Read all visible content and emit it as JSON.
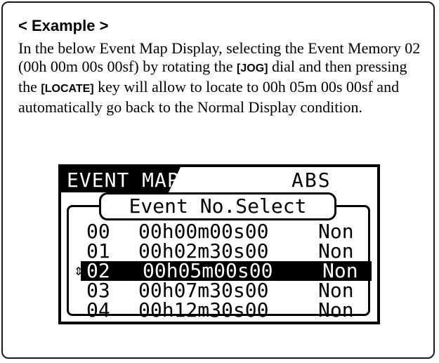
{
  "heading": "< Example >",
  "paragraph": {
    "t1": "In the below Event Map Display, selecting the Event Memory 02 (00h 00m 00s 00sf) by rotating the ",
    "key1": "[JOG]",
    "t2": " dial and then pressing the ",
    "key2": "[LOCATE]",
    "t3": " key will allow to locate to 00h 05m 00s 00sf and automatically go back to the Normal Display condition."
  },
  "lcd": {
    "title": "EVENT MAP",
    "mode": "ABS",
    "subtitle": "Event No.Select",
    "cursor": "⇕",
    "rows": [
      {
        "num": "00",
        "time": "00h00m00s00",
        "status": "Non",
        "selected": false
      },
      {
        "num": "01",
        "time": "00h02m30s00",
        "status": "Non",
        "selected": false
      },
      {
        "num": "02",
        "time": "00h05m00s00",
        "status": "Non",
        "selected": true
      },
      {
        "num": "03",
        "time": "00h07m30s00",
        "status": "Non",
        "selected": false
      },
      {
        "num": "04",
        "time": "00h12m30s00",
        "status": "Non",
        "selected": false
      }
    ]
  }
}
